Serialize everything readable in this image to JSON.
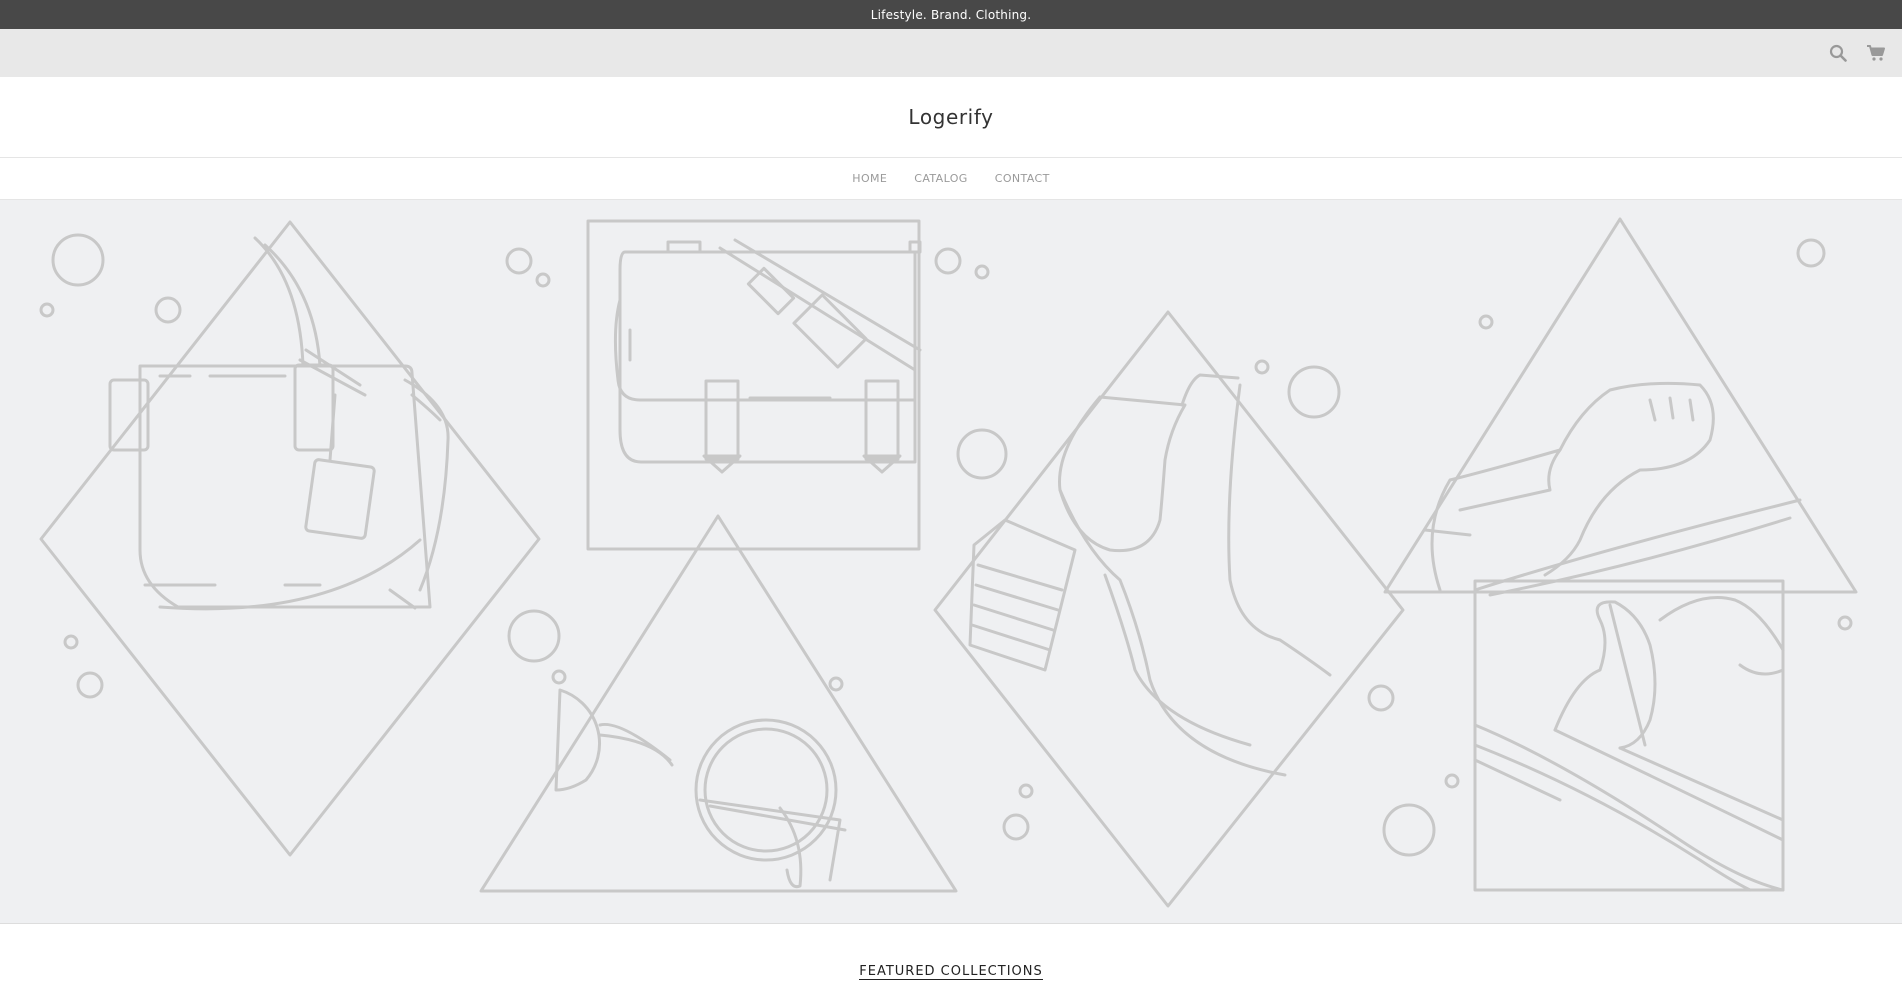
{
  "announcement": {
    "text": "Lifestyle. Brand. Clothing."
  },
  "utility": {
    "icons": [
      "search-icon",
      "cart-icon"
    ]
  },
  "header": {
    "logo": "Logerify"
  },
  "nav": {
    "items": [
      {
        "label": "HOME"
      },
      {
        "label": "CATALOG"
      },
      {
        "label": "CONTACT"
      }
    ]
  },
  "hero": {
    "illustrations": [
      "handbag",
      "messenger-bag",
      "glasses",
      "high-heel",
      "oxford-shoe",
      "feather-hat"
    ]
  },
  "featured": {
    "title": "FEATURED COLLECTIONS"
  },
  "colors": {
    "announcement_bg": "#484848",
    "utility_bg": "#e8e8e8",
    "hero_bg": "#eff0f2",
    "line": "#c8c8c8"
  }
}
